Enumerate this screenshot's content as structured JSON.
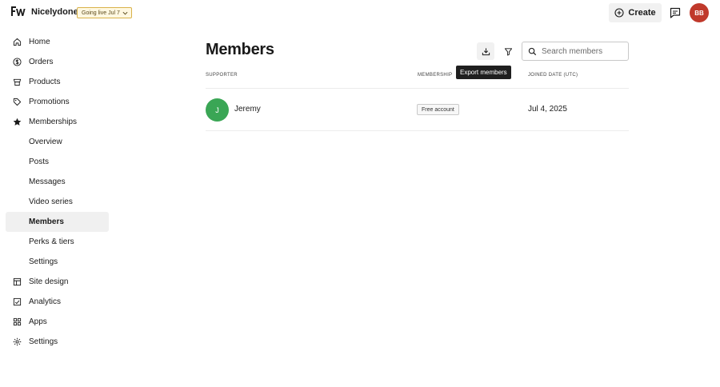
{
  "header": {
    "site_name": "Nicelydone",
    "live_badge": "Going live Jul 7",
    "create_label": "Create",
    "user_initials": "BB"
  },
  "sidebar": {
    "items": [
      {
        "label": "Home",
        "icon": "home-icon"
      },
      {
        "label": "Orders",
        "icon": "dollar-circle-icon"
      },
      {
        "label": "Products",
        "icon": "tag-icon"
      },
      {
        "label": "Promotions",
        "icon": "percent-tag-icon"
      },
      {
        "label": "Memberships",
        "icon": "star-icon"
      },
      {
        "label": "Overview",
        "icon": ""
      },
      {
        "label": "Posts",
        "icon": ""
      },
      {
        "label": "Messages",
        "icon": ""
      },
      {
        "label": "Video series",
        "icon": ""
      },
      {
        "label": "Members",
        "icon": "",
        "active": true
      },
      {
        "label": "Perks & tiers",
        "icon": ""
      },
      {
        "label": "Settings",
        "icon": ""
      },
      {
        "label": "Site design",
        "icon": "layout-icon"
      },
      {
        "label": "Analytics",
        "icon": "chart-check-icon"
      },
      {
        "label": "Apps",
        "icon": "grid-icon"
      },
      {
        "label": "Settings",
        "icon": "gear-icon"
      }
    ]
  },
  "main": {
    "title": "Members",
    "search_placeholder": "Search members",
    "tooltip": "Export members",
    "columns": {
      "supporter": "SUPPORTER",
      "membership": "MEMBERSHIP",
      "joined": "JOINED DATE (UTC)"
    },
    "rows": [
      {
        "initial": "J",
        "name": "Jeremy",
        "membership": "Free account",
        "joined": "Jul 4, 2025"
      }
    ]
  },
  "colors": {
    "member_avatar": "#3aa655",
    "user_avatar": "#c0392b",
    "badge_border": "#d9b24a"
  }
}
